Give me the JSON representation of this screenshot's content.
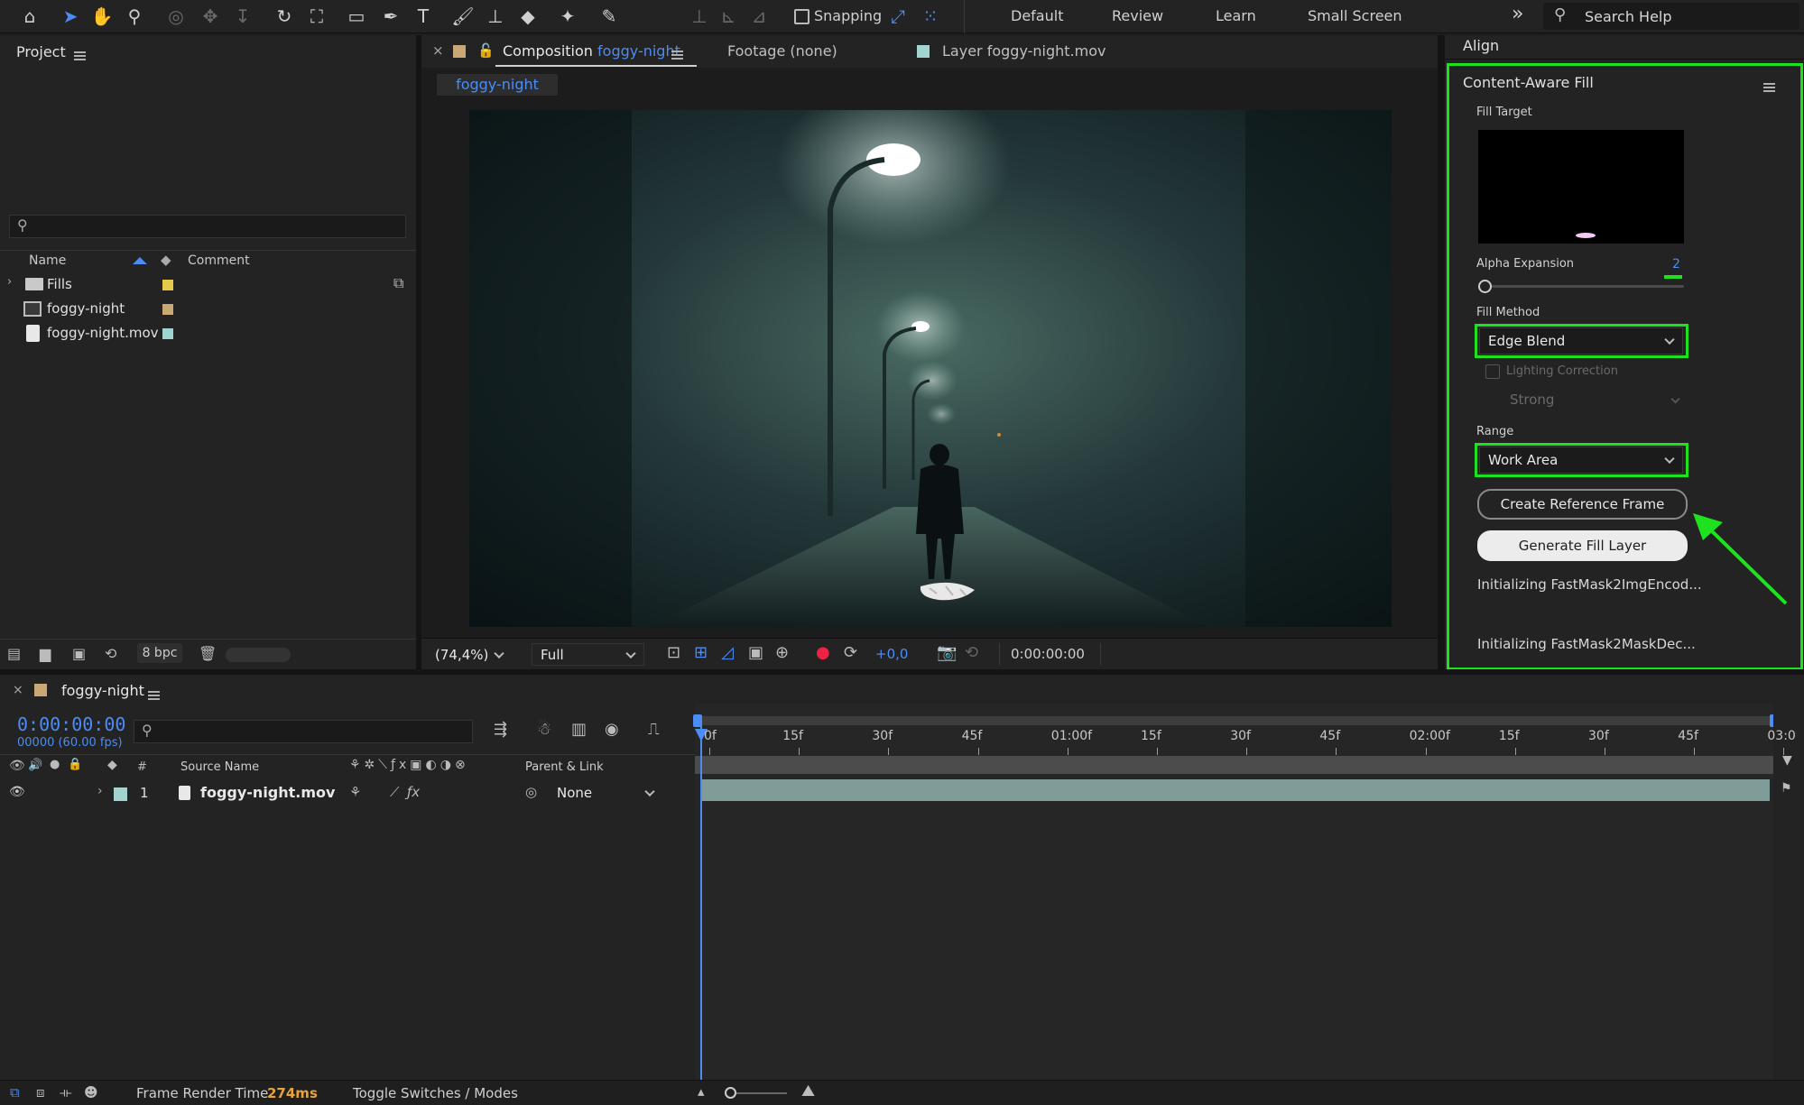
{
  "toolbar": {
    "tools": [
      "home-icon",
      "selection-arrow-icon",
      "hand-icon",
      "zoom-icon",
      "orbit-camera-icon",
      "pan-camera-icon",
      "dolly-camera-icon",
      "rotate-icon",
      "pan-behind-icon",
      "rectangle-icon",
      "pen-icon",
      "type-icon",
      "brush-icon",
      "clone-stamp-icon",
      "eraser-icon",
      "roto-brush-icon",
      "puppet-pin-icon"
    ],
    "snapping_label": "Snapping",
    "workspaces": [
      "Default",
      "Review",
      "Learn",
      "Small Screen"
    ],
    "overflow": "»",
    "search_placeholder": "Search Help"
  },
  "project": {
    "title": "Project",
    "columns": {
      "name": "Name",
      "comment": "Comment"
    },
    "items": [
      {
        "name": "Fills",
        "type": "folder",
        "color": "#e6c84a"
      },
      {
        "name": "foggy-night",
        "type": "composition",
        "color": "#c9a876"
      },
      {
        "name": "foggy-night.mov",
        "type": "footage",
        "color": "#9fd4d0"
      }
    ],
    "bpc": "8 bpc"
  },
  "viewer": {
    "tabs": [
      {
        "prefix": "Composition",
        "name": "foggy-night"
      },
      {
        "label": "Footage (none)"
      },
      {
        "prefix": "Layer",
        "name": "foggy-night.mov"
      }
    ],
    "subtab": "foggy-night",
    "zoom": "(74,4%)",
    "resolution": "Full",
    "exposure": "+0,0",
    "timecode": "0:00:00:00"
  },
  "align": {
    "title": "Align"
  },
  "caf": {
    "title": "Content-Aware Fill",
    "fill_target_label": "Fill Target",
    "alpha_expansion_label": "Alpha Expansion",
    "alpha_expansion_value": "2",
    "alpha_expansion_fraction": 0.02,
    "fill_method_label": "Fill Method",
    "fill_method_value": "Edge Blend",
    "lighting_correction_label": "Lighting Correction",
    "lighting_strength": "Strong",
    "range_label": "Range",
    "range_value": "Work Area",
    "create_ref_button": "Create Reference Frame",
    "generate_button": "Generate Fill Layer",
    "status1": "Initializing FastMask2ImgEncod...",
    "status2": "Initializing FastMask2MaskDec..."
  },
  "timeline": {
    "comp_name": "foggy-night",
    "timecode": "0:00:00:00",
    "frames": "00000 (60.00 fps)",
    "columns": {
      "num": "#",
      "source": "Source Name",
      "parent": "Parent & Link"
    },
    "ruler": [
      "0f",
      "15f",
      "30f",
      "45f",
      "01:00f",
      "15f",
      "30f",
      "45f",
      "02:00f",
      "15f",
      "30f",
      "45f",
      "03:0"
    ],
    "layer": {
      "num": "1",
      "name": "foggy-night.mov",
      "parent": "None",
      "color": "#9fd4d0"
    }
  },
  "status": {
    "render_label": "Frame Render Time",
    "render_value": "274ms",
    "toggle": "Toggle Switches / Modes"
  },
  "colors": {
    "accent_blue": "#4c8cf5",
    "highlight_green": "#1fe21f",
    "render_orange": "#e8a33c"
  }
}
